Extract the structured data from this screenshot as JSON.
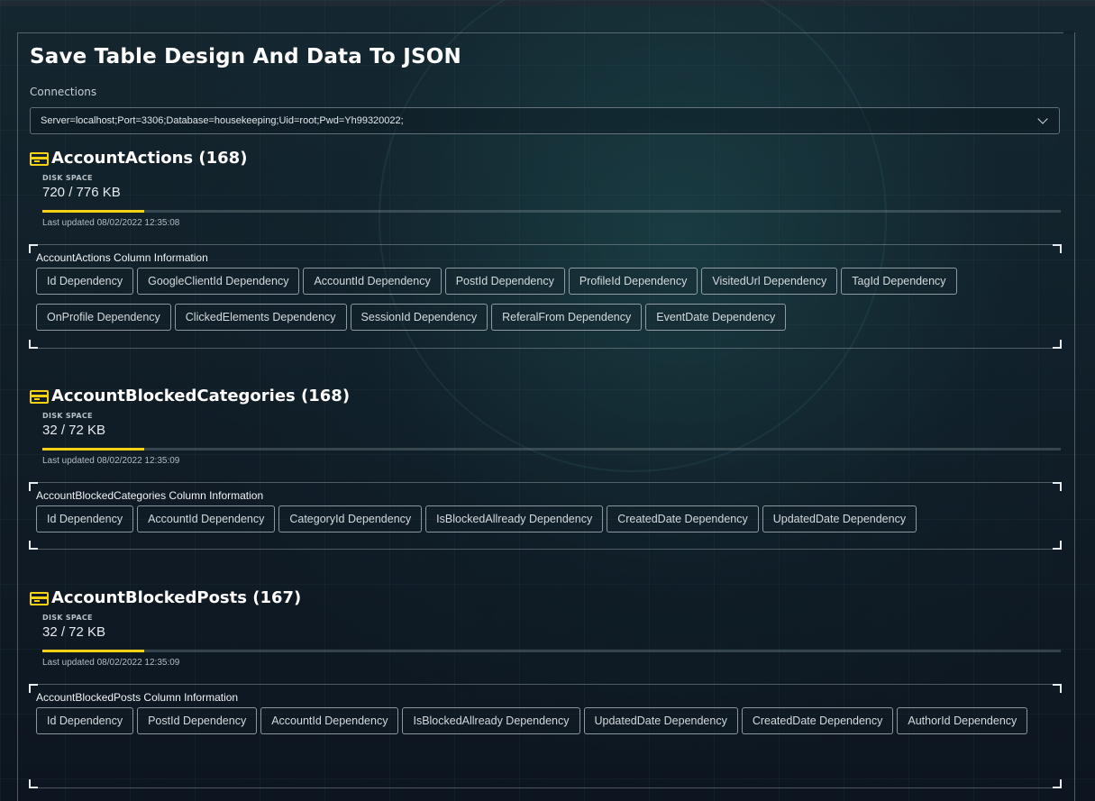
{
  "page": {
    "title": "Save Table Design And Data To JSON",
    "connections_label": "Connections",
    "connection_value": "Server=localhost;Port=3306;Database=housekeeping;Uid=root;Pwd=Yh99320022;"
  },
  "tables": [
    {
      "name": "AccountActions (168)",
      "disk_label": "DISK SPACE",
      "disk_value": "720 / 776 KB",
      "disk_fill_fraction": 0.1,
      "last_updated": "Last updated 08/02/2022 12:35:08",
      "columns_title": "AccountActions Column Information",
      "columns": [
        "Id Dependency",
        "GoogleClientId Dependency",
        "AccountId Dependency",
        "PostId Dependency",
        "ProfileId Dependency",
        "VisitedUrl Dependency",
        "TagId Dependency",
        "OnProfile Dependency",
        "ClickedElements Dependency",
        "SessionId Dependency",
        "ReferalFrom Dependency",
        "EventDate Dependency"
      ]
    },
    {
      "name": "AccountBlockedCategories (168)",
      "disk_label": "DISK SPACE",
      "disk_value": "32 / 72 KB",
      "disk_fill_fraction": 0.1,
      "last_updated": "Last updated 08/02/2022 12:35:09",
      "columns_title": "AccountBlockedCategories Column Information",
      "columns": [
        "Id Dependency",
        "AccountId Dependency",
        "CategoryId Dependency",
        "IsBlockedAllready Dependency",
        "CreatedDate Dependency",
        "UpdatedDate Dependency"
      ]
    },
    {
      "name": "AccountBlockedPosts (167)",
      "disk_label": "DISK SPACE",
      "disk_value": "32 / 72 KB",
      "disk_fill_fraction": 0.1,
      "last_updated": "Last updated 08/02/2022 12:35:09",
      "columns_title": "AccountBlockedPosts Column Information",
      "columns": [
        "Id Dependency",
        "PostId Dependency",
        "AccountId Dependency",
        "IsBlockedAllready Dependency",
        "UpdatedDate Dependency",
        "CreatedDate Dependency",
        "AuthorId Dependency"
      ]
    }
  ],
  "colors": {
    "accent": "#f5d116",
    "background": "#122029"
  },
  "icons": {
    "table": "credit-card-icon",
    "dropdown": "chevron-down-icon"
  }
}
